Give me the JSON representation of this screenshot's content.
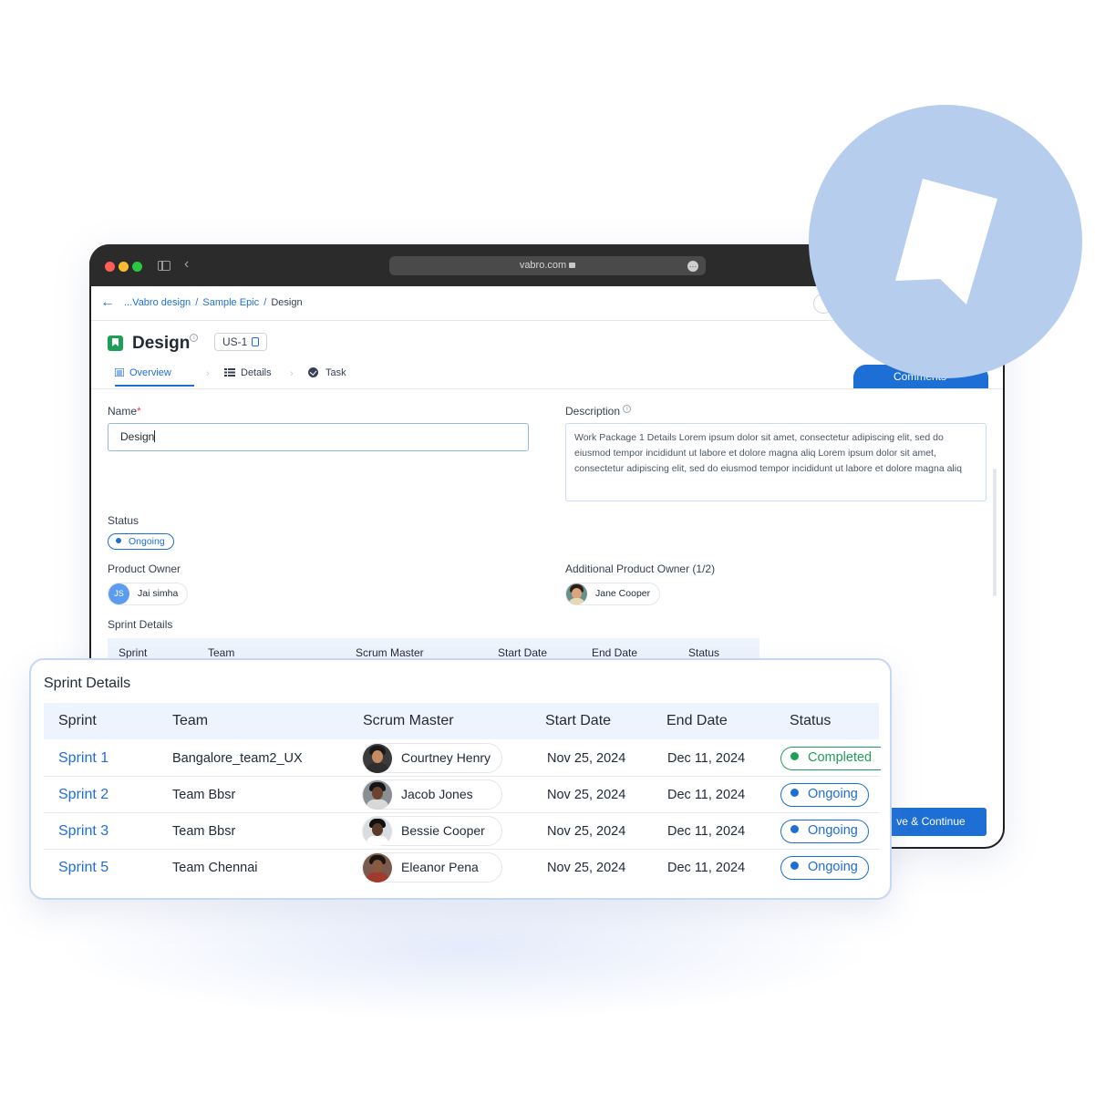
{
  "browser": {
    "url": "vabro.com",
    "colors": {
      "close": "#ff5f57",
      "minimize": "#febc2e",
      "maximize": "#28c840"
    }
  },
  "breadcrumb": {
    "items": [
      "...Vabro design",
      "Sample Epic",
      "Design"
    ],
    "separator": "/"
  },
  "item": {
    "title": "Design",
    "id_chip": "US-1",
    "icon_color": "#1e9e57"
  },
  "tabs": [
    {
      "label": "Overview",
      "icon": "list-icon",
      "active": true
    },
    {
      "label": "Details",
      "icon": "details-icon",
      "active": false
    },
    {
      "label": "Task",
      "icon": "check-circle-icon",
      "active": false
    }
  ],
  "comments_button": {
    "label": "Comments"
  },
  "form": {
    "name_label": "Name",
    "required_mark": "*",
    "name_value": "Design",
    "description_label": "Description",
    "description_value": "Work Package 1 Details Lorem ipsum dolor sit amet, consectetur adipiscing elit, sed do eiusmod tempor incididunt ut labore et dolore magna aliq Lorem ipsum dolor sit amet, consectetur adipiscing elit, sed do eiusmod tempor incididunt ut labore et dolore magna aliq",
    "status_label": "Status",
    "status_value": "Ongoing",
    "product_owner_label": "Product Owner",
    "product_owner": {
      "initials": "JS",
      "name": "Jai simha"
    },
    "additional_owner_label": "Additional Product Owner (1/2)",
    "additional_owner": {
      "name": "Jane Cooper"
    },
    "sprint_details_label": "Sprint Details"
  },
  "background_table_headers": [
    "Sprint",
    "Team",
    "Scrum Master",
    "Start Date",
    "End Date",
    "Status"
  ],
  "save_button": {
    "label": "ve & Continue"
  },
  "sprint_card": {
    "title": "Sprint Details",
    "headers": [
      "Sprint",
      "Team",
      "Scrum Master",
      "Start Date",
      "End Date",
      "Status"
    ],
    "rows": [
      {
        "sprint": "Sprint 1",
        "team": "Bangalore_team2_UX",
        "scrum_master": "Courtney Henry",
        "start": "Nov 25, 2024",
        "end": "Dec 11, 2024",
        "status": "Completed"
      },
      {
        "sprint": "Sprint 2",
        "team": "Team Bbsr",
        "scrum_master": "Jacob Jones",
        "start": "Nov 25, 2024",
        "end": "Dec 11, 2024",
        "status": "Ongoing"
      },
      {
        "sprint": "Sprint 3",
        "team": "Team Bbsr",
        "scrum_master": "Bessie Cooper",
        "start": "Nov 25, 2024",
        "end": "Dec 11, 2024",
        "status": "Ongoing"
      },
      {
        "sprint": "Sprint 5",
        "team": "Team Chennai",
        "scrum_master": "Eleanor Pena",
        "start": "Nov 25, 2024",
        "end": "Dec 11, 2024",
        "status": "Ongoing"
      }
    ]
  },
  "colors": {
    "accent": "#1d6fd6",
    "completed": "#1e9e57",
    "decor_circle": "#b7cdee",
    "table_header_bg": "#eef4fd"
  }
}
